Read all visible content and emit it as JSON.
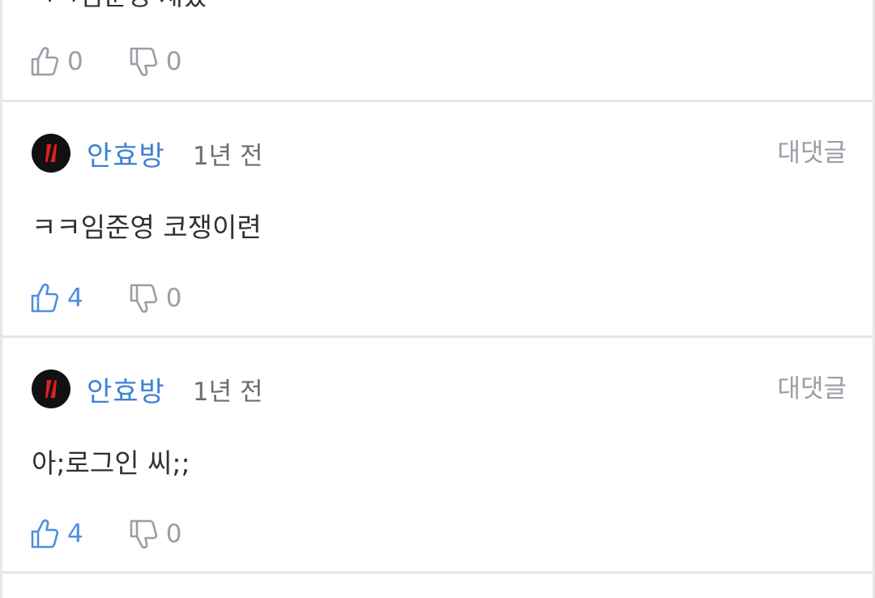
{
  "comments": [
    {
      "partial": true,
      "body": "ㅋㅋ임준영 재밌",
      "likes": "0",
      "dislikes": "0",
      "liked": false
    },
    {
      "author": "안효방",
      "time": "1년 전",
      "reply_label": "대댓글",
      "body": "ㅋㅋ임준영 코쟁이련",
      "likes": "4",
      "dislikes": "0",
      "liked": true
    },
    {
      "author": "안효방",
      "time": "1년 전",
      "reply_label": "대댓글",
      "body": "아;로그인 씨;;",
      "likes": "4",
      "dislikes": "0",
      "liked": true
    }
  ],
  "icons": {
    "like": "thumbs-up-icon",
    "dislike": "thumbs-down-icon",
    "avatar": "avatar-logo"
  },
  "colors": {
    "author": "#3d80d6",
    "like_active": "#4d8fe3",
    "muted": "#9a9ea6",
    "divider": "#e6e7ea"
  }
}
